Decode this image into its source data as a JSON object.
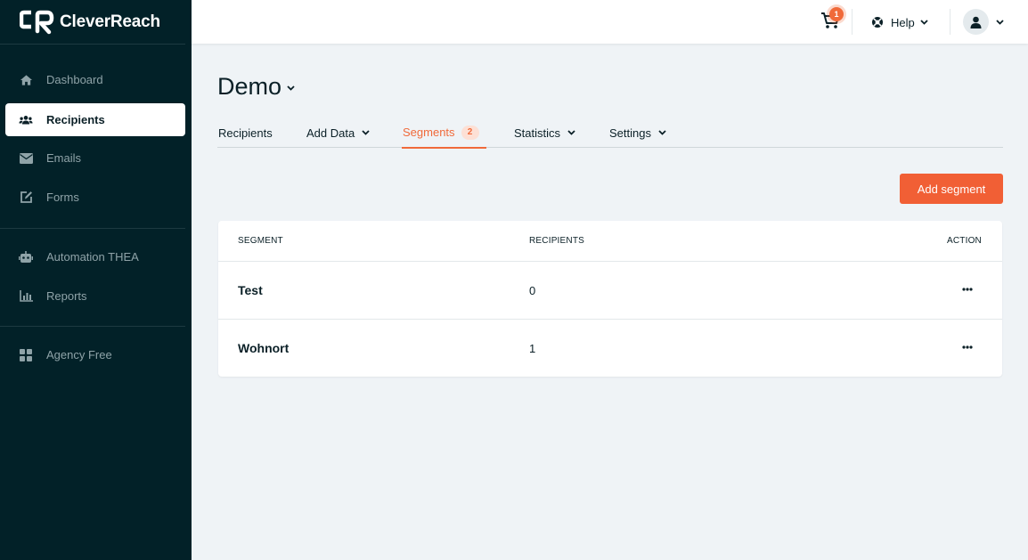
{
  "brand": {
    "name": "CleverReach"
  },
  "sidebar": {
    "items": [
      {
        "label": "Dashboard",
        "icon": "home-icon"
      },
      {
        "label": "Recipients",
        "icon": "users-icon",
        "active": true
      },
      {
        "label": "Emails",
        "icon": "envelope-icon"
      },
      {
        "label": "Forms",
        "icon": "edit-icon"
      },
      {
        "label": "Automation THEA",
        "icon": "robot-icon"
      },
      {
        "label": "Reports",
        "icon": "chart-icon"
      },
      {
        "label": "Agency Free",
        "icon": "grid-icon"
      }
    ]
  },
  "topbar": {
    "cart_count": "1",
    "help_label": "Help"
  },
  "page": {
    "title": "Demo"
  },
  "tabs": [
    {
      "label": "Recipients"
    },
    {
      "label": "Add Data"
    },
    {
      "label": "Segments",
      "badge": "2",
      "active": true
    },
    {
      "label": "Statistics"
    },
    {
      "label": "Settings"
    }
  ],
  "actions": {
    "add_segment": "Add segment"
  },
  "table": {
    "headers": {
      "segment": "SEGMENT",
      "recipients": "RECIPIENTS",
      "action": "ACTION"
    },
    "rows": [
      {
        "segment": "Test",
        "recipients": "0"
      },
      {
        "segment": "Wohnort",
        "recipients": "1"
      }
    ]
  },
  "colors": {
    "sidebar": "#022128",
    "accent": "#f15f35",
    "background": "#eff3f6"
  }
}
